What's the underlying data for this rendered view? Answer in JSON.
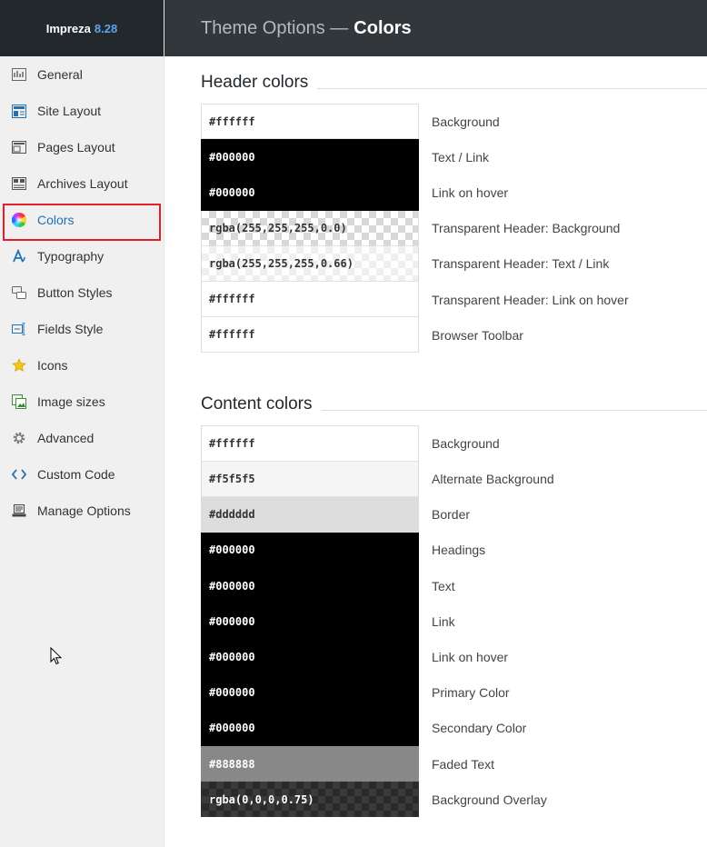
{
  "brand": {
    "name": "Impreza",
    "version": "8.28"
  },
  "topbar": {
    "parent": "Theme Options —",
    "current": "Colors"
  },
  "sidebar": {
    "items": [
      {
        "label": "General",
        "icon": "general-icon"
      },
      {
        "label": "Site Layout",
        "icon": "site-layout-icon"
      },
      {
        "label": "Pages Layout",
        "icon": "pages-layout-icon"
      },
      {
        "label": "Archives Layout",
        "icon": "archives-layout-icon"
      },
      {
        "label": "Colors",
        "icon": "color-wheel-icon",
        "active": true
      },
      {
        "label": "Typography",
        "icon": "typography-icon"
      },
      {
        "label": "Button Styles",
        "icon": "button-styles-icon"
      },
      {
        "label": "Fields Style",
        "icon": "fields-style-icon"
      },
      {
        "label": "Icons",
        "icon": "star-icon"
      },
      {
        "label": "Image sizes",
        "icon": "image-sizes-icon"
      },
      {
        "label": "Advanced",
        "icon": "gear-icon"
      },
      {
        "label": "Custom Code",
        "icon": "code-icon"
      },
      {
        "label": "Manage Options",
        "icon": "manage-options-icon"
      }
    ]
  },
  "header_colors": {
    "title": "Header colors",
    "rows": [
      {
        "value": "#ffffff",
        "label": "Background"
      },
      {
        "value": "#000000",
        "label": "Text / Link"
      },
      {
        "value": "#000000",
        "label": "Link on hover"
      },
      {
        "value": "rgba(255,255,255,0.0)",
        "label": "Transparent Header: Background"
      },
      {
        "value": "rgba(255,255,255,0.66)",
        "label": "Transparent Header: Text / Link"
      },
      {
        "value": "#ffffff",
        "label": "Transparent Header: Link on hover"
      },
      {
        "value": "#ffffff",
        "label": "Browser Toolbar"
      }
    ]
  },
  "content_colors": {
    "title": "Content colors",
    "rows": [
      {
        "value": "#ffffff",
        "label": "Background"
      },
      {
        "value": "#f5f5f5",
        "label": "Alternate Background"
      },
      {
        "value": "#dddddd",
        "label": "Border"
      },
      {
        "value": "#000000",
        "label": "Headings"
      },
      {
        "value": "#000000",
        "label": "Text"
      },
      {
        "value": "#000000",
        "label": "Link"
      },
      {
        "value": "#000000",
        "label": "Link on hover"
      },
      {
        "value": "#000000",
        "label": "Primary Color"
      },
      {
        "value": "#000000",
        "label": "Secondary Color"
      },
      {
        "value": "#888888",
        "label": "Faded Text"
      },
      {
        "value": "rgba(0,0,0,0.75)",
        "label": "Background Overlay"
      }
    ]
  }
}
